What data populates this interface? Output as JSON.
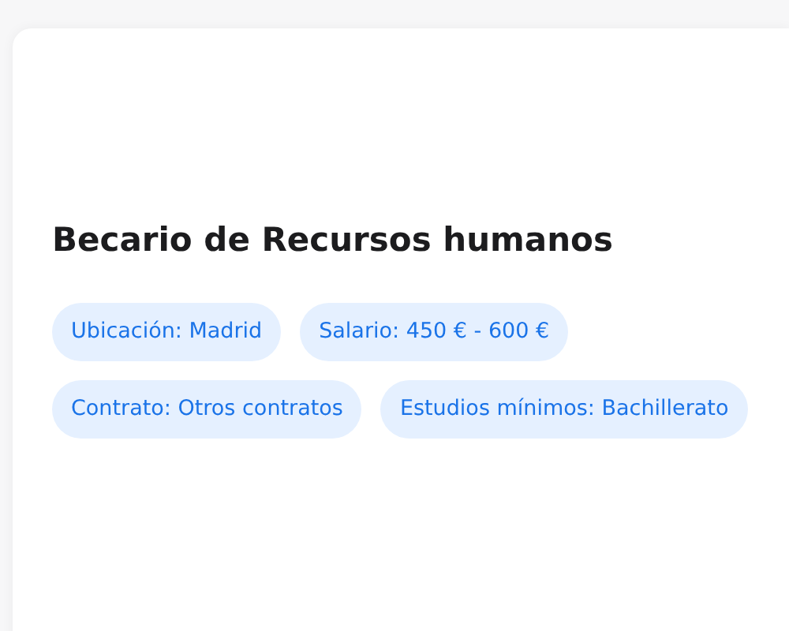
{
  "job": {
    "title": "Becario de Recursos humanos",
    "tags": [
      "Ubicación: Madrid",
      "Salario: 450 € - 600 €",
      "Contrato: Otros contratos",
      "Estudios mínimos: Bachillerato"
    ]
  }
}
